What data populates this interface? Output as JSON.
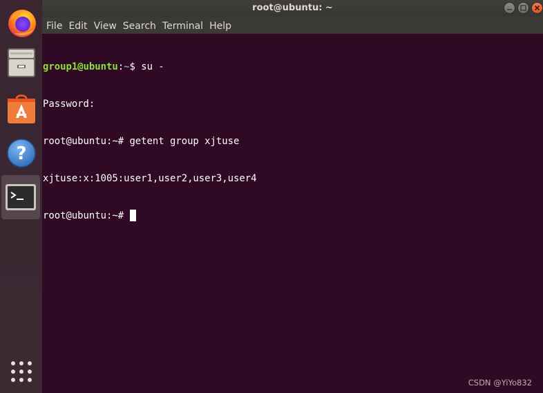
{
  "window": {
    "title": "root@ubuntu: ~"
  },
  "menu": [
    "File",
    "Edit",
    "View",
    "Search",
    "Terminal",
    "Help"
  ],
  "dock": {
    "items": [
      {
        "name": "firefox",
        "icon": "firefox-icon"
      },
      {
        "name": "files",
        "icon": "files-icon"
      },
      {
        "name": "software",
        "icon": "software-store-icon"
      },
      {
        "name": "help",
        "icon": "help-icon",
        "glyph": "?"
      },
      {
        "name": "terminal",
        "icon": "terminal-icon",
        "active": true
      }
    ],
    "show_apps_icon": "apps-grid-icon"
  },
  "terminal": {
    "lines": [
      {
        "user": "group1@ubuntu",
        "sep": ":",
        "path": "~",
        "sym": "$ ",
        "text": "su -"
      },
      {
        "text": "Password:"
      },
      {
        "text": "root@ubuntu:~# getent group xjtuse"
      },
      {
        "text": "xjtuse:x:1005:user1,user2,user3,user4"
      },
      {
        "text": "root@ubuntu:~# "
      }
    ]
  },
  "watermark": "CSDN @YiYo832",
  "colors": {
    "terminal_bg": "#300a24",
    "prompt_user": "#8ae234",
    "prompt_path": "#729fcf",
    "close_button": "#e95420"
  }
}
